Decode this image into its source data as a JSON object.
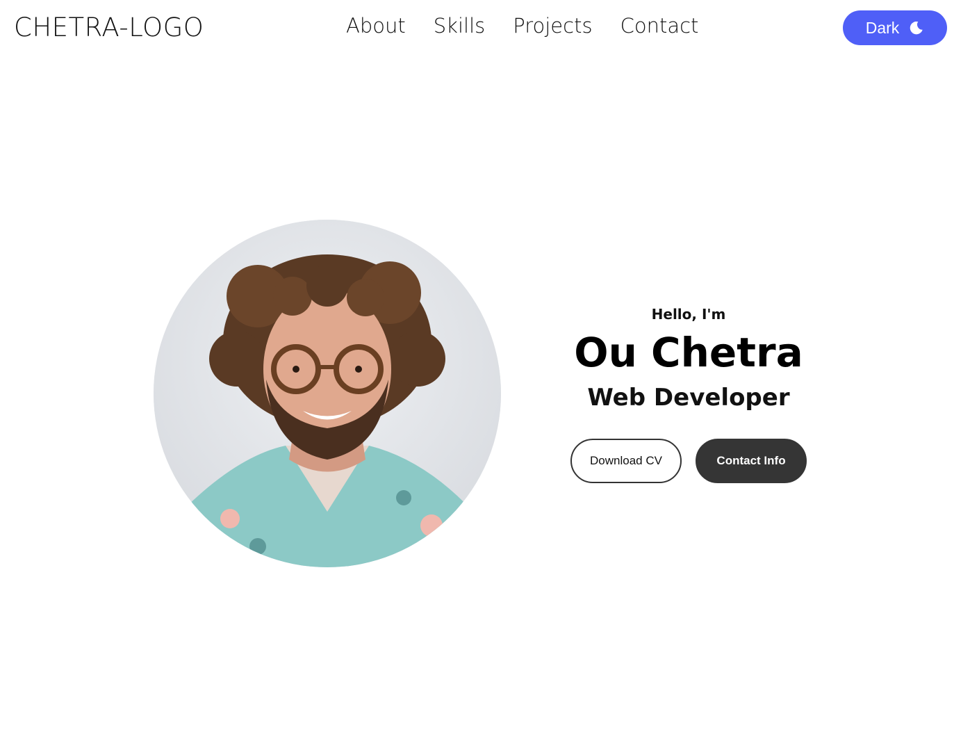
{
  "header": {
    "logo": "CHETRA-LOGO",
    "nav": [
      {
        "label": "About"
      },
      {
        "label": "Skills"
      },
      {
        "label": "Projects"
      },
      {
        "label": "Contact"
      }
    ],
    "theme_toggle": {
      "label": "Dark",
      "icon": "moon-icon",
      "color": "#4f5ff7"
    }
  },
  "hero": {
    "photo": "profile-photo",
    "greeting": "Hello, I'm",
    "name": "Ou Chetra",
    "role": "Web Developer",
    "buttons": {
      "download": "Download CV",
      "contact": "Contact Info"
    }
  }
}
